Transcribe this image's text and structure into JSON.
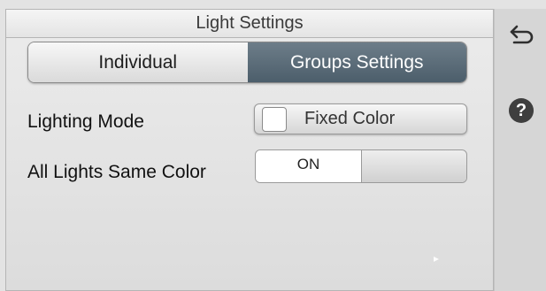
{
  "header": {
    "title": "Light Settings"
  },
  "tabs": [
    {
      "label": "Individual",
      "active": false
    },
    {
      "label": "Groups Settings",
      "active": true
    }
  ],
  "settings": {
    "lighting_mode": {
      "label": "Lighting Mode",
      "value": "Fixed Color",
      "swatch_color": "#ffffff"
    },
    "same_color": {
      "label": "All Lights Same Color",
      "state_label": "ON"
    }
  },
  "sidebar": {
    "back_icon": "back-arrow-icon",
    "help_icon": "help-icon",
    "help_glyph": "?"
  },
  "colors": {
    "active_tab": "#56686f",
    "inactive_tab": "#e6e6e6",
    "background": "#e3e3e3"
  }
}
